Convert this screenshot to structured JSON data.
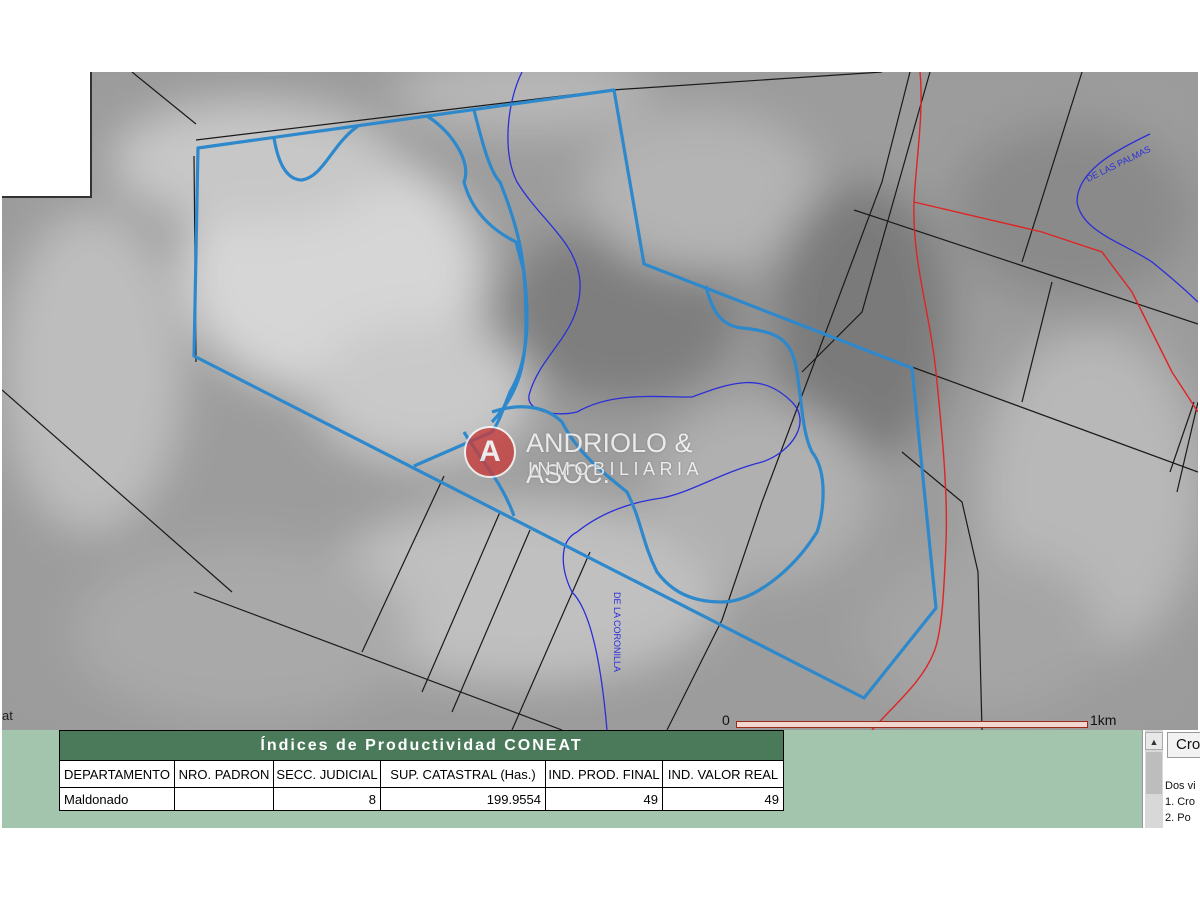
{
  "map": {
    "edge_label": "at",
    "roads": {
      "palmas": "DE LAS PALMAS",
      "coronilla": "DE LA CORONILLA"
    },
    "scale": {
      "start": "0",
      "end": "1km"
    },
    "watermark": {
      "letter": "A",
      "line1": "ANDRIOLO & ASOC.",
      "line2": "INMOBILIARIA"
    },
    "colors": {
      "parcel": "#2d88cc",
      "stream": "#2a2fd8",
      "route": "#e02323",
      "boundary": "#1a1a1a"
    }
  },
  "table": {
    "title": "Índices de Productividad CONEAT",
    "headers": [
      "DEPARTAMENTO",
      "NRO. PADRON",
      "SECC. JUDICIAL",
      "SUP. CATASTRAL (Has.)",
      "IND. PROD. FINAL",
      "IND. VALOR REAL"
    ],
    "row": {
      "departamento": "Maldonado",
      "padron": "",
      "seccion": "8",
      "superficie": "199.9554",
      "ind_prod": "49",
      "ind_valor": "49"
    }
  },
  "side_panel": {
    "button_label": "Cro",
    "line1": "Dos vi",
    "line2": "1. Cro",
    "line3": "2. Po"
  }
}
